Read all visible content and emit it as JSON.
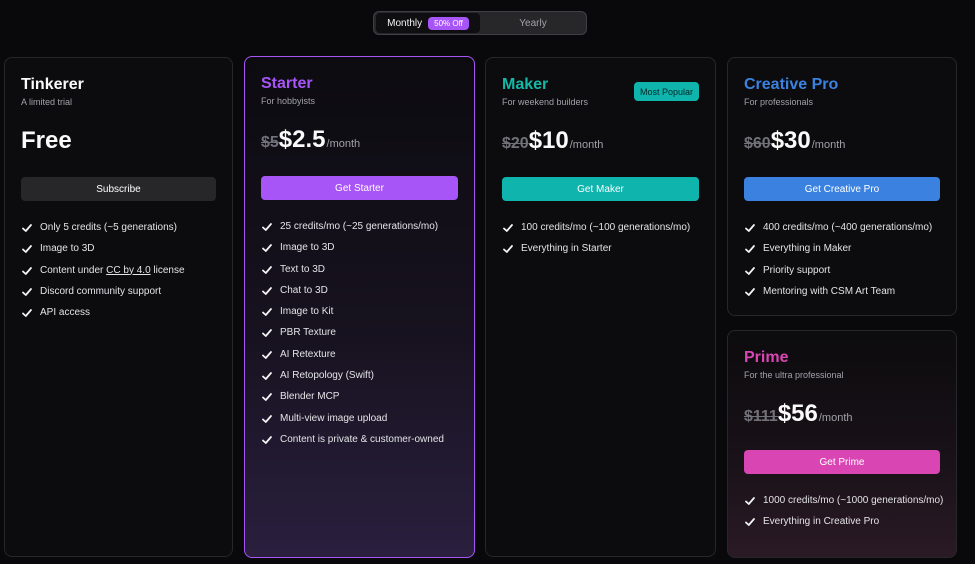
{
  "billing_toggle": {
    "monthly_label": "Monthly",
    "discount_badge": "50% Off",
    "yearly_label": "Yearly"
  },
  "plans": {
    "tinkerer": {
      "title": "Tinkerer",
      "subtitle": "A limited trial",
      "price": "Free",
      "cta": "Subscribe",
      "features": {
        "f1": "Only 5 credits (~5 generations)",
        "f2": "Image to 3D",
        "f3_prefix": "Content under ",
        "f3_link": "CC by 4.0",
        "f3_suffix": " license",
        "f4": "Discord community support",
        "f5": "API access"
      }
    },
    "starter": {
      "title": "Starter",
      "subtitle": "For hobbyists",
      "old_price": "$5",
      "price": "$2.5",
      "per": "/month",
      "cta": "Get Starter",
      "features": [
        "25 credits/mo (~25 generations/mo)",
        "Image to 3D",
        "Text to 3D",
        "Chat to 3D",
        "Image to Kit",
        "PBR Texture",
        "AI Retexture",
        "AI Retopology (Swift)",
        "Blender MCP",
        "Multi-view image upload",
        "Content is private & customer-owned"
      ]
    },
    "maker": {
      "title": "Maker",
      "subtitle": "For weekend builders",
      "badge": "Most Popular",
      "old_price": "$20",
      "price": "$10",
      "per": "/month",
      "cta": "Get Maker",
      "features": [
        "100 credits/mo (~100 generations/mo)",
        "Everything in Starter"
      ]
    },
    "creative_pro": {
      "title": "Creative Pro",
      "subtitle": "For professionals",
      "old_price": "$60",
      "price": "$30",
      "per": "/month",
      "cta": "Get Creative Pro",
      "features": [
        "400 credits/mo (~400 generations/mo)",
        "Everything in Maker",
        "Priority support",
        "Mentoring with CSM Art Team"
      ]
    },
    "prime": {
      "title": "Prime",
      "subtitle": "For the ultra professional",
      "old_price": "$111",
      "price": "$56",
      "per": "/month",
      "cta": "Get Prime",
      "features": [
        "1000 credits/mo (~1000 generations/mo)",
        "Everything in Creative Pro"
      ]
    }
  },
  "colors": {
    "background": "#09090b",
    "starter_accent": "#a855f7",
    "maker_accent": "#0fb5ad",
    "creative_pro_accent": "#3b82e0",
    "prime_accent": "#d946b4",
    "subscribe_button": "#27272a"
  },
  "icons": {
    "feature_check": "check-icon"
  }
}
